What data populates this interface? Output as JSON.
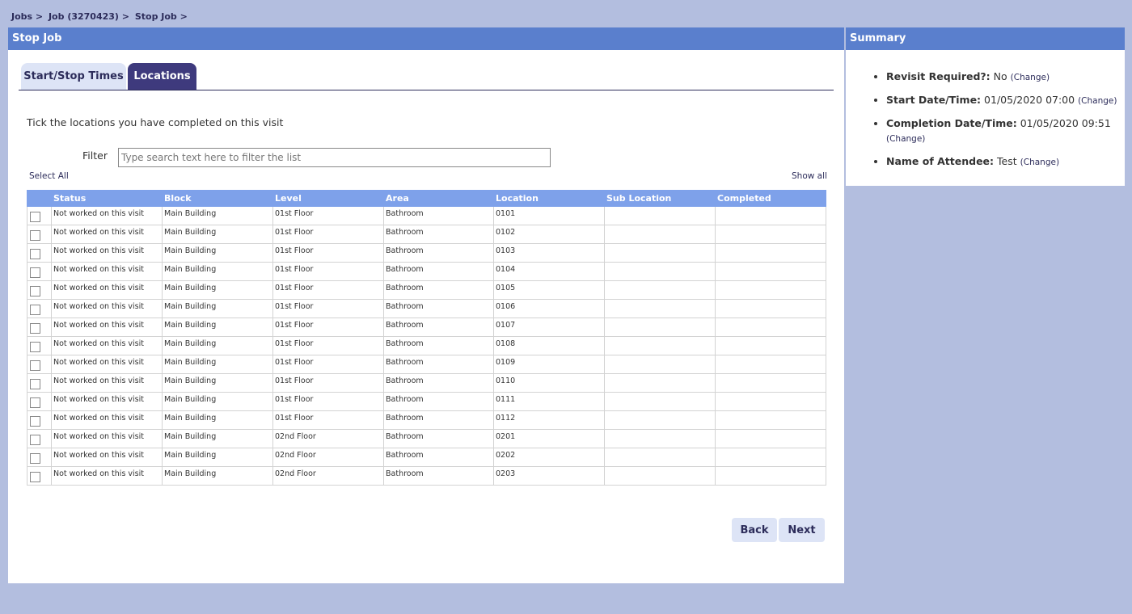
{
  "breadcrumb": [
    "Jobs >",
    "Job (3270423) >",
    "Stop Job >"
  ],
  "main": {
    "title": "Stop Job",
    "tabs": [
      {
        "label": "Start/Stop Times"
      },
      {
        "label": "Locations"
      }
    ],
    "instruction": "Tick the locations you have completed on this visit",
    "filter_label": "Filter",
    "filter_placeholder": "Type search text here to filter the list",
    "filter_value": "",
    "select_all": "Select All",
    "show_all": "Show all",
    "table": {
      "headers": [
        "Status",
        "Block",
        "Level",
        "Area",
        "Location",
        "Sub Location",
        "Completed"
      ],
      "rows": [
        [
          "Not worked on this visit",
          "Main Building",
          "01st Floor",
          "Bathroom",
          "0101",
          "",
          ""
        ],
        [
          "Not worked on this visit",
          "Main Building",
          "01st Floor",
          "Bathroom",
          "0102",
          "",
          ""
        ],
        [
          "Not worked on this visit",
          "Main Building",
          "01st Floor",
          "Bathroom",
          "0103",
          "",
          ""
        ],
        [
          "Not worked on this visit",
          "Main Building",
          "01st Floor",
          "Bathroom",
          "0104",
          "",
          ""
        ],
        [
          "Not worked on this visit",
          "Main Building",
          "01st Floor",
          "Bathroom",
          "0105",
          "",
          ""
        ],
        [
          "Not worked on this visit",
          "Main Building",
          "01st Floor",
          "Bathroom",
          "0106",
          "",
          ""
        ],
        [
          "Not worked on this visit",
          "Main Building",
          "01st Floor",
          "Bathroom",
          "0107",
          "",
          ""
        ],
        [
          "Not worked on this visit",
          "Main Building",
          "01st Floor",
          "Bathroom",
          "0108",
          "",
          ""
        ],
        [
          "Not worked on this visit",
          "Main Building",
          "01st Floor",
          "Bathroom",
          "0109",
          "",
          ""
        ],
        [
          "Not worked on this visit",
          "Main Building",
          "01st Floor",
          "Bathroom",
          "0110",
          "",
          ""
        ],
        [
          "Not worked on this visit",
          "Main Building",
          "01st Floor",
          "Bathroom",
          "0111",
          "",
          ""
        ],
        [
          "Not worked on this visit",
          "Main Building",
          "01st Floor",
          "Bathroom",
          "0112",
          "",
          ""
        ],
        [
          "Not worked on this visit",
          "Main Building",
          "02nd Floor",
          "Bathroom",
          "0201",
          "",
          ""
        ],
        [
          "Not worked on this visit",
          "Main Building",
          "02nd Floor",
          "Bathroom",
          "0202",
          "",
          ""
        ],
        [
          "Not worked on this visit",
          "Main Building",
          "02nd Floor",
          "Bathroom",
          "0203",
          "",
          ""
        ]
      ]
    },
    "back_label": "Back",
    "next_label": "Next"
  },
  "summary": {
    "title": "Summary",
    "change_label": "(Change)",
    "items": [
      {
        "label": "Revisit Required?:",
        "value": "No"
      },
      {
        "label": "Start Date/Time:",
        "value": "01/05/2020 07:00"
      },
      {
        "label": "Completion Date/Time:",
        "value": "01/05/2020 09:51"
      },
      {
        "label": "Name of Attendee:",
        "value": "Test"
      }
    ]
  },
  "colors": {
    "background": "#b3bedf",
    "header": "#5a7fcd",
    "table_header": "#7ea1ea",
    "active_tab": "#3e3a7d",
    "inactive_tab": "#dde4f6"
  }
}
